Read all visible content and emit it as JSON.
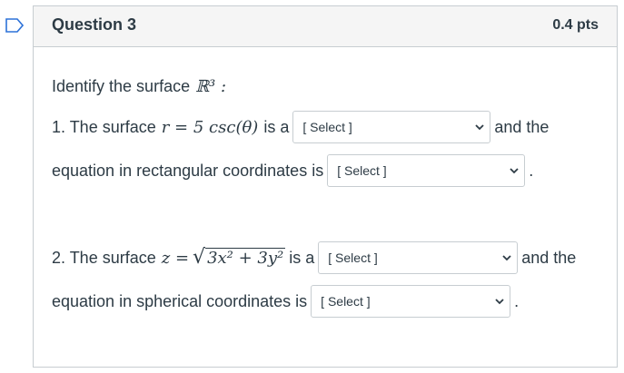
{
  "question": {
    "title": "Question 3",
    "points": "0.4 pts",
    "prompt_text": "Identify the surface",
    "prompt_symbol": "ℝ³ :"
  },
  "part1": {
    "text_a": "1. The surface",
    "equation": "r = 5 csc(θ)",
    "text_b": "is a",
    "select1_value": "[ Select ]",
    "text_c": "and the",
    "text_d": "equation in rectangular coordinates is",
    "select2_value": "[ Select ]",
    "text_e": "."
  },
  "part2": {
    "text_a": "2. The surface",
    "eq_lhs": "z =",
    "eq_radicand": "3x² + 3y²",
    "text_b": "is a",
    "select1_value": "[ Select ]",
    "text_c": "and the",
    "text_d": "equation in spherical coordinates is",
    "select2_value": "[ Select ]",
    "text_e": "."
  },
  "colors": {
    "flag": "#2d72d8",
    "border": "#c7cdd1",
    "header_bg": "#f5f5f5",
    "text": "#2d3b45"
  },
  "icons": {
    "flag": "bookmark-flag-icon",
    "dropdown": "chevron-down-icon"
  }
}
